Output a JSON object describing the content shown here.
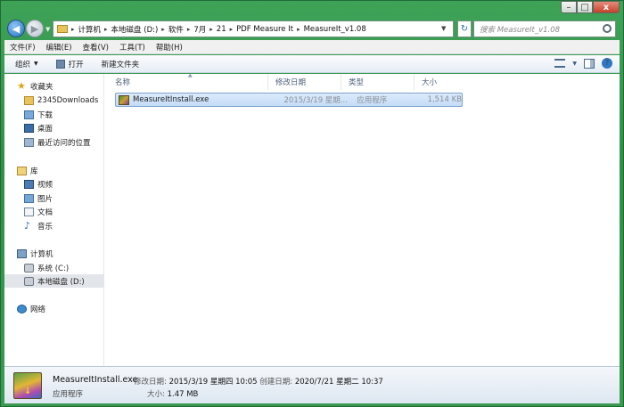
{
  "window": {
    "controls": {
      "minimize": "–",
      "maximize": "□",
      "close": "x"
    }
  },
  "address": {
    "crumbs": [
      "计算机",
      "本地磁盘 (D:)",
      "软件",
      "7月",
      "21",
      "PDF Measure It",
      "MeasureIt_v1.08"
    ],
    "search_placeholder": "搜索 MeasureIt_v1.08"
  },
  "menu": [
    "文件(F)",
    "编辑(E)",
    "查看(V)",
    "工具(T)",
    "帮助(H)"
  ],
  "toolbar": {
    "organize": "组织",
    "open": "打开",
    "new_folder": "新建文件夹"
  },
  "nav": {
    "favorites": "收藏夹",
    "fav_items": [
      "2345Downloads",
      "下载",
      "桌面",
      "最近访问的位置"
    ],
    "libraries": "库",
    "lib_items": [
      "视频",
      "图片",
      "文档",
      "音乐"
    ],
    "computer": "计算机",
    "computer_items": [
      "系统 (C:)",
      "本地磁盘 (D:)"
    ],
    "network": "网络"
  },
  "columns": {
    "name": "名称",
    "modified": "修改日期",
    "type": "类型",
    "size": "大小"
  },
  "files": [
    {
      "name": "MeasureItInstall.exe",
      "modified": "2015/3/19 星期...",
      "type": "应用程序",
      "size": "1,514 KB"
    }
  ],
  "details": {
    "name": "MeasureItInstall.exe",
    "type": "应用程序",
    "modified_label": "修改日期:",
    "modified_value": "2015/3/19 星期四 10:05",
    "created_label": "创建日期:",
    "created_value": "2020/7/21 星期二 10:37",
    "size_label": "大小:",
    "size_value": "1.47 MB"
  },
  "colors": {
    "titlebar": "#2e9148",
    "selection": "#c4dcf7"
  }
}
